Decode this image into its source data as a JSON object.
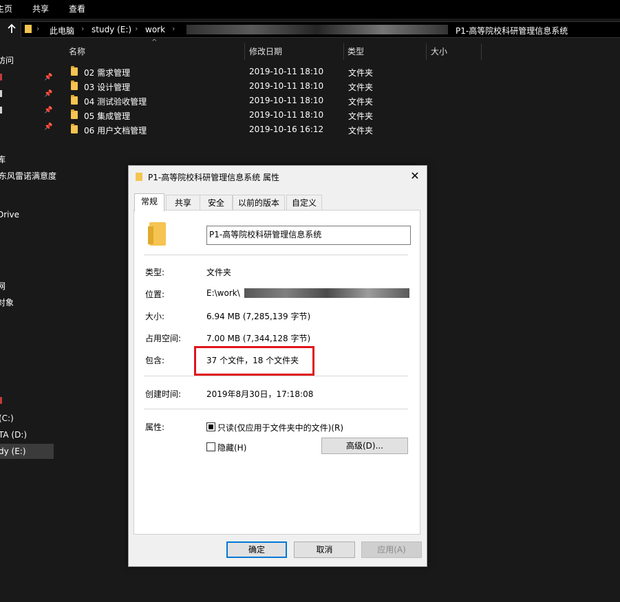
{
  "ribbon": {
    "tabs": [
      "主页",
      "共享",
      "查看"
    ]
  },
  "address": {
    "crumbs": [
      "此电脑",
      "study (E:)",
      "work",
      "P1-高等院校科研管理信息系统"
    ]
  },
  "nav": {
    "items": [
      "访问",
      "",
      "",
      "",
      "",
      "库",
      "东风雷诺满意度",
      "",
      "Drive",
      "",
      "",
      "",
      "",
      "对象",
      "",
      "",
      "",
      "",
      "",
      "",
      "(C:)",
      "TA (D:)",
      "dy (E:)"
    ]
  },
  "columns": {
    "name": "名称",
    "modified": "修改日期",
    "type": "类型",
    "size": "大小"
  },
  "files": [
    {
      "name": "02 需求管理",
      "modified": "2019-10-11 18:10",
      "type": "文件夹"
    },
    {
      "name": "03 设计管理",
      "modified": "2019-10-11 18:10",
      "type": "文件夹"
    },
    {
      "name": "04 测试验收管理",
      "modified": "2019-10-11 18:10",
      "type": "文件夹"
    },
    {
      "name": "05 集成管理",
      "modified": "2019-10-11 18:10",
      "type": "文件夹"
    },
    {
      "name": "06 用户文档管理",
      "modified": "2019-10-16 16:12",
      "type": "文件夹"
    }
  ],
  "dialog": {
    "title": "P1-高等院校科研管理信息系统 属性",
    "close": "✕",
    "tabs": [
      "常规",
      "共享",
      "安全",
      "以前的版本",
      "自定义"
    ],
    "folder_name": "P1-高等院校科研管理信息系统",
    "labels": {
      "type": "类型:",
      "location": "位置:",
      "size": "大小:",
      "size_on_disk": "占用空间:",
      "contains": "包含:",
      "created": "创建时间:",
      "attributes": "属性:"
    },
    "values": {
      "type": "文件夹",
      "location": "E:\\work\\",
      "size": "6.94 MB (7,285,139 字节)",
      "size_on_disk": "7.00 MB (7,344,128 字节)",
      "contains": "37 个文件，18 个文件夹",
      "created": "2019年8月30日，17:18:08"
    },
    "attributes": {
      "readonly": "只读(仅应用于文件夹中的文件)(R)",
      "hidden": "隐藏(H)",
      "advanced": "高级(D)..."
    },
    "buttons": {
      "ok": "确定",
      "cancel": "取消",
      "apply": "应用(A)"
    }
  },
  "colors": {
    "highlight": "#e0151b",
    "folder": "#f5c451",
    "primary_border": "#0078d7"
  }
}
